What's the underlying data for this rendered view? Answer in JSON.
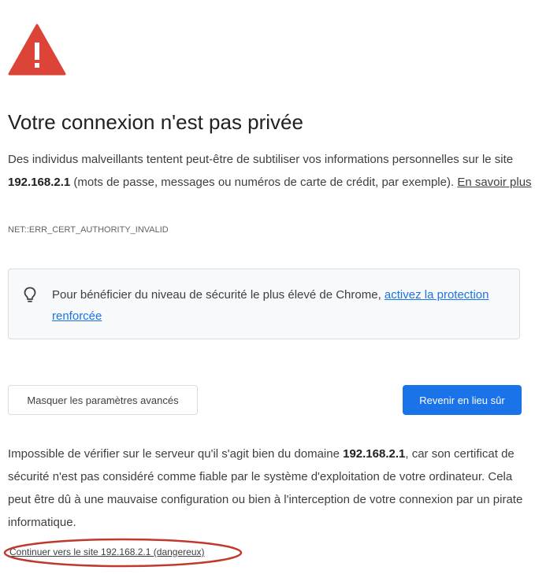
{
  "icons": {
    "warning": "warning-triangle-icon",
    "lightbulb": "lightbulb-icon"
  },
  "colors": {
    "warning_red": "#db4437",
    "primary_button": "#1a73e8",
    "link_blue": "#1a73e8",
    "annotation_red": "#c0392b"
  },
  "interstitial": {
    "title": "Votre connexion n'est pas privée",
    "intro_before": "Des individus malveillants tentent peut-être de subtiliser vos informations personnelles sur le site ",
    "host": "192.168.2.1",
    "intro_after": " (mots de passe, messages ou numéros de carte de crédit, par exemple). ",
    "learn_more": "En savoir plus",
    "error_code": "NET::ERR_CERT_AUTHORITY_INVALID"
  },
  "tip": {
    "text": "Pour bénéficier du niveau de sécurité le plus élevé de Chrome, ",
    "link": "activez la protection renforcée"
  },
  "buttons": {
    "advanced": "Masquer les paramètres avancés",
    "back_to_safety": "Revenir en lieu sûr"
  },
  "details": {
    "before": "Impossible de vérifier sur le serveur qu'il s'agit bien du domaine ",
    "host": "192.168.2.1",
    "after": ", car son certificat de sécurité n'est pas considéré comme fiable par le système d'exploitation de votre ordinateur. Cela peut être dû à une mauvaise configuration ou bien à l'interception de votre connexion par un pirate informatique."
  },
  "proceed_link": "Continuer vers le site 192.168.2.1 (dangereux)"
}
